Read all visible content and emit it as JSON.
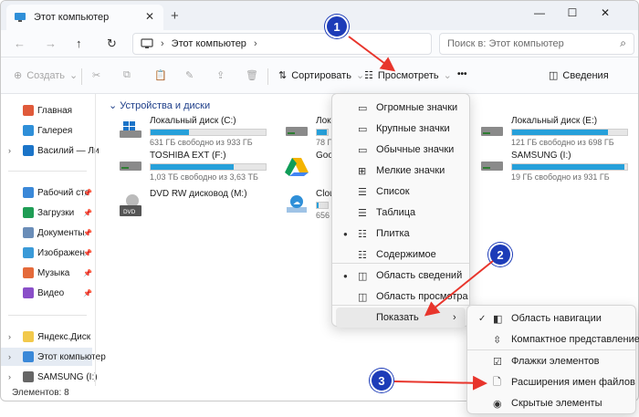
{
  "window": {
    "tab_title": "Этот компьютер",
    "new_tab": "+",
    "close": "✕",
    "minimize": "—",
    "maximize": "☐",
    "close_window": "✕"
  },
  "nav": {
    "back": "←",
    "forward": "→",
    "up": "↑",
    "refresh": "↻",
    "breadcrumb": [
      "Этот компьютер"
    ],
    "search_placeholder": "Поиск в: Этот компьютер"
  },
  "toolbar": {
    "create": "Создать",
    "sort": "Сортировать",
    "view": "Просмотреть",
    "more": "•••",
    "details": "Сведения"
  },
  "sidebar": {
    "items": [
      {
        "label": "Главная",
        "icon": "home-icon",
        "color": "#e05a3a"
      },
      {
        "label": "Галерея",
        "icon": "gallery-icon",
        "color": "#2f8fd8"
      },
      {
        "label": "Василий — Ли",
        "icon": "cloud-icon",
        "color": "#1b74c8"
      },
      {
        "label": "Рабочий сто",
        "icon": "desktop-icon",
        "color": "#3a88d8"
      },
      {
        "label": "Загрузки",
        "icon": "downloads-icon",
        "color": "#1f9d55"
      },
      {
        "label": "Документы",
        "icon": "documents-icon",
        "color": "#6a8db8"
      },
      {
        "label": "Изображен",
        "icon": "pictures-icon",
        "color": "#3a9ad8"
      },
      {
        "label": "Музыка",
        "icon": "music-icon",
        "color": "#e46a3a"
      },
      {
        "label": "Видео",
        "icon": "video-icon",
        "color": "#8a4fc8"
      },
      {
        "label": "Яндекс.Диск",
        "icon": "yandex-disk-icon",
        "color": "#f2c94c"
      },
      {
        "label": "Этот компьютер",
        "icon": "computer-icon",
        "color": "#3a88d8"
      },
      {
        "label": "SAMSUNG (I:)",
        "icon": "drive-icon",
        "color": "#666666"
      }
    ]
  },
  "status": "Элементов: 8",
  "section_title": "Устройства и диски",
  "drives": [
    {
      "name": "Локальный диск (C:)",
      "free": "631 ГБ свободно из 933 ГБ",
      "fill": 0.33,
      "icon": "windows-drive-icon"
    },
    {
      "name": "Локальный диск (E:)",
      "free": "121 ГБ свободно из 698 ГБ",
      "fill": 0.83,
      "icon": "hdd-icon"
    },
    {
      "name": "TOSHIBA EXT (F:)",
      "free": "1,03 ТБ свободно из 3,63 ТБ",
      "fill": 0.72,
      "icon": "hdd-icon"
    },
    {
      "name": "SAMSUNG (I:)",
      "free": "19 ГБ свободно из 931 ГБ",
      "fill": 0.98,
      "icon": "hdd-icon"
    },
    {
      "name": "DVD RW дисковод (M:)",
      "free": "",
      "fill": null,
      "icon": "dvd-icon"
    },
    {
      "name": "Локальный",
      "free": "78 ГБ",
      "fill": 0.9,
      "icon": "hdd-icon"
    },
    {
      "name": "Goog",
      "free": "",
      "fill": null,
      "icon": "google-drive-icon"
    },
    {
      "name": "Cloud",
      "free": "656",
      "fill": 0.2,
      "icon": "cloud-drive-icon"
    }
  ],
  "view_menu": {
    "items": [
      {
        "label": "Огромные значки",
        "icon": "▭",
        "selected": false
      },
      {
        "label": "Крупные значки",
        "icon": "▭",
        "selected": false
      },
      {
        "label": "Обычные значки",
        "icon": "▭",
        "selected": false
      },
      {
        "label": "Мелкие значки",
        "icon": "⊞",
        "selected": false
      },
      {
        "label": "Список",
        "icon": "☰",
        "selected": false
      },
      {
        "label": "Таблица",
        "icon": "☰",
        "selected": false
      },
      {
        "label": "Плитка",
        "icon": "☷",
        "selected": true
      },
      {
        "label": "Содержимое",
        "icon": "☷",
        "selected": false
      },
      {
        "label": "Область сведений",
        "icon": "◫",
        "selected": true
      },
      {
        "label": "Область просмотра",
        "icon": "◫",
        "selected": false
      },
      {
        "label": "Показать",
        "icon": "",
        "selected": false
      }
    ],
    "submenu_chevron": "›"
  },
  "show_menu": {
    "items": [
      {
        "label": "Область навигации",
        "icon": "◧",
        "checked": true
      },
      {
        "label": "Компактное представление",
        "icon": "⇳",
        "checked": false
      },
      {
        "label": "Флажки элементов",
        "icon": "☑",
        "checked": false
      },
      {
        "label": "Расширения имен файлов",
        "icon": "🗋",
        "checked": false
      },
      {
        "label": "Скрытые элементы",
        "icon": "◉",
        "checked": false
      }
    ],
    "check": "✓"
  },
  "callouts": [
    "1",
    "2",
    "3"
  ],
  "colors": {
    "accent": "#26a0da",
    "callout": "#1d3cb8",
    "arrow": "#e8352c",
    "section": "#1f3f8a"
  }
}
